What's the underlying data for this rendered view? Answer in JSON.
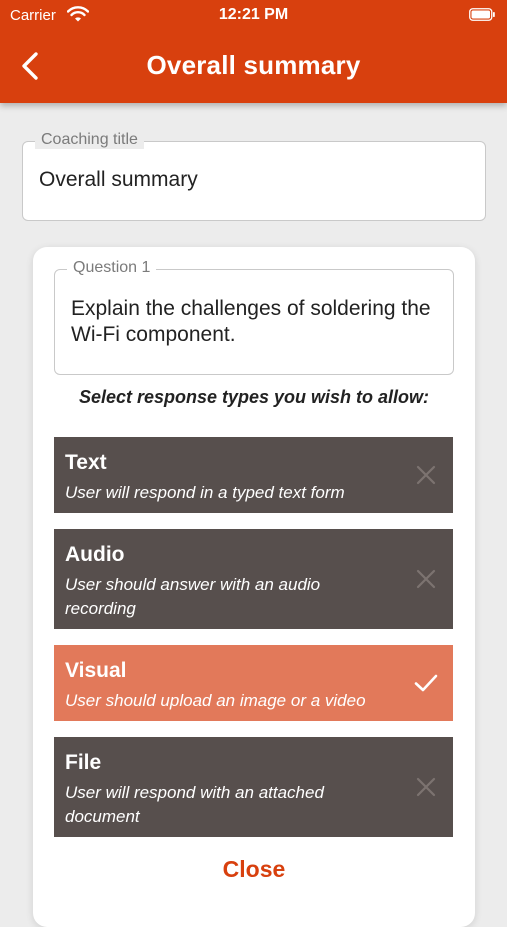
{
  "status": {
    "carrier": "Carrier",
    "time": "12:21 PM"
  },
  "header": {
    "title": "Overall summary"
  },
  "coaching": {
    "legend": "Coaching title",
    "value": "Overall summary"
  },
  "question": {
    "legend": "Question 1",
    "value": "Explain the challenges of soldering the Wi-Fi component."
  },
  "instruction": "Select response types you wish to allow:",
  "options": [
    {
      "label": "Text",
      "description": "User will respond in a typed text form",
      "selected": false
    },
    {
      "label": "Audio",
      "description": "User should answer with an audio recording",
      "selected": false
    },
    {
      "label": "Visual",
      "description": "User should upload an image or a video",
      "selected": true
    },
    {
      "label": "File",
      "description": "User will respond with an attached document",
      "selected": false
    }
  ],
  "close_label": "Close",
  "colors": {
    "accent": "#d8400e",
    "option_bg": "#574f4d",
    "option_selected_bg": "#e2795a"
  },
  "icons": {
    "back": "chevron-left-icon",
    "unselected": "close-icon",
    "selected": "checkmark-icon"
  }
}
